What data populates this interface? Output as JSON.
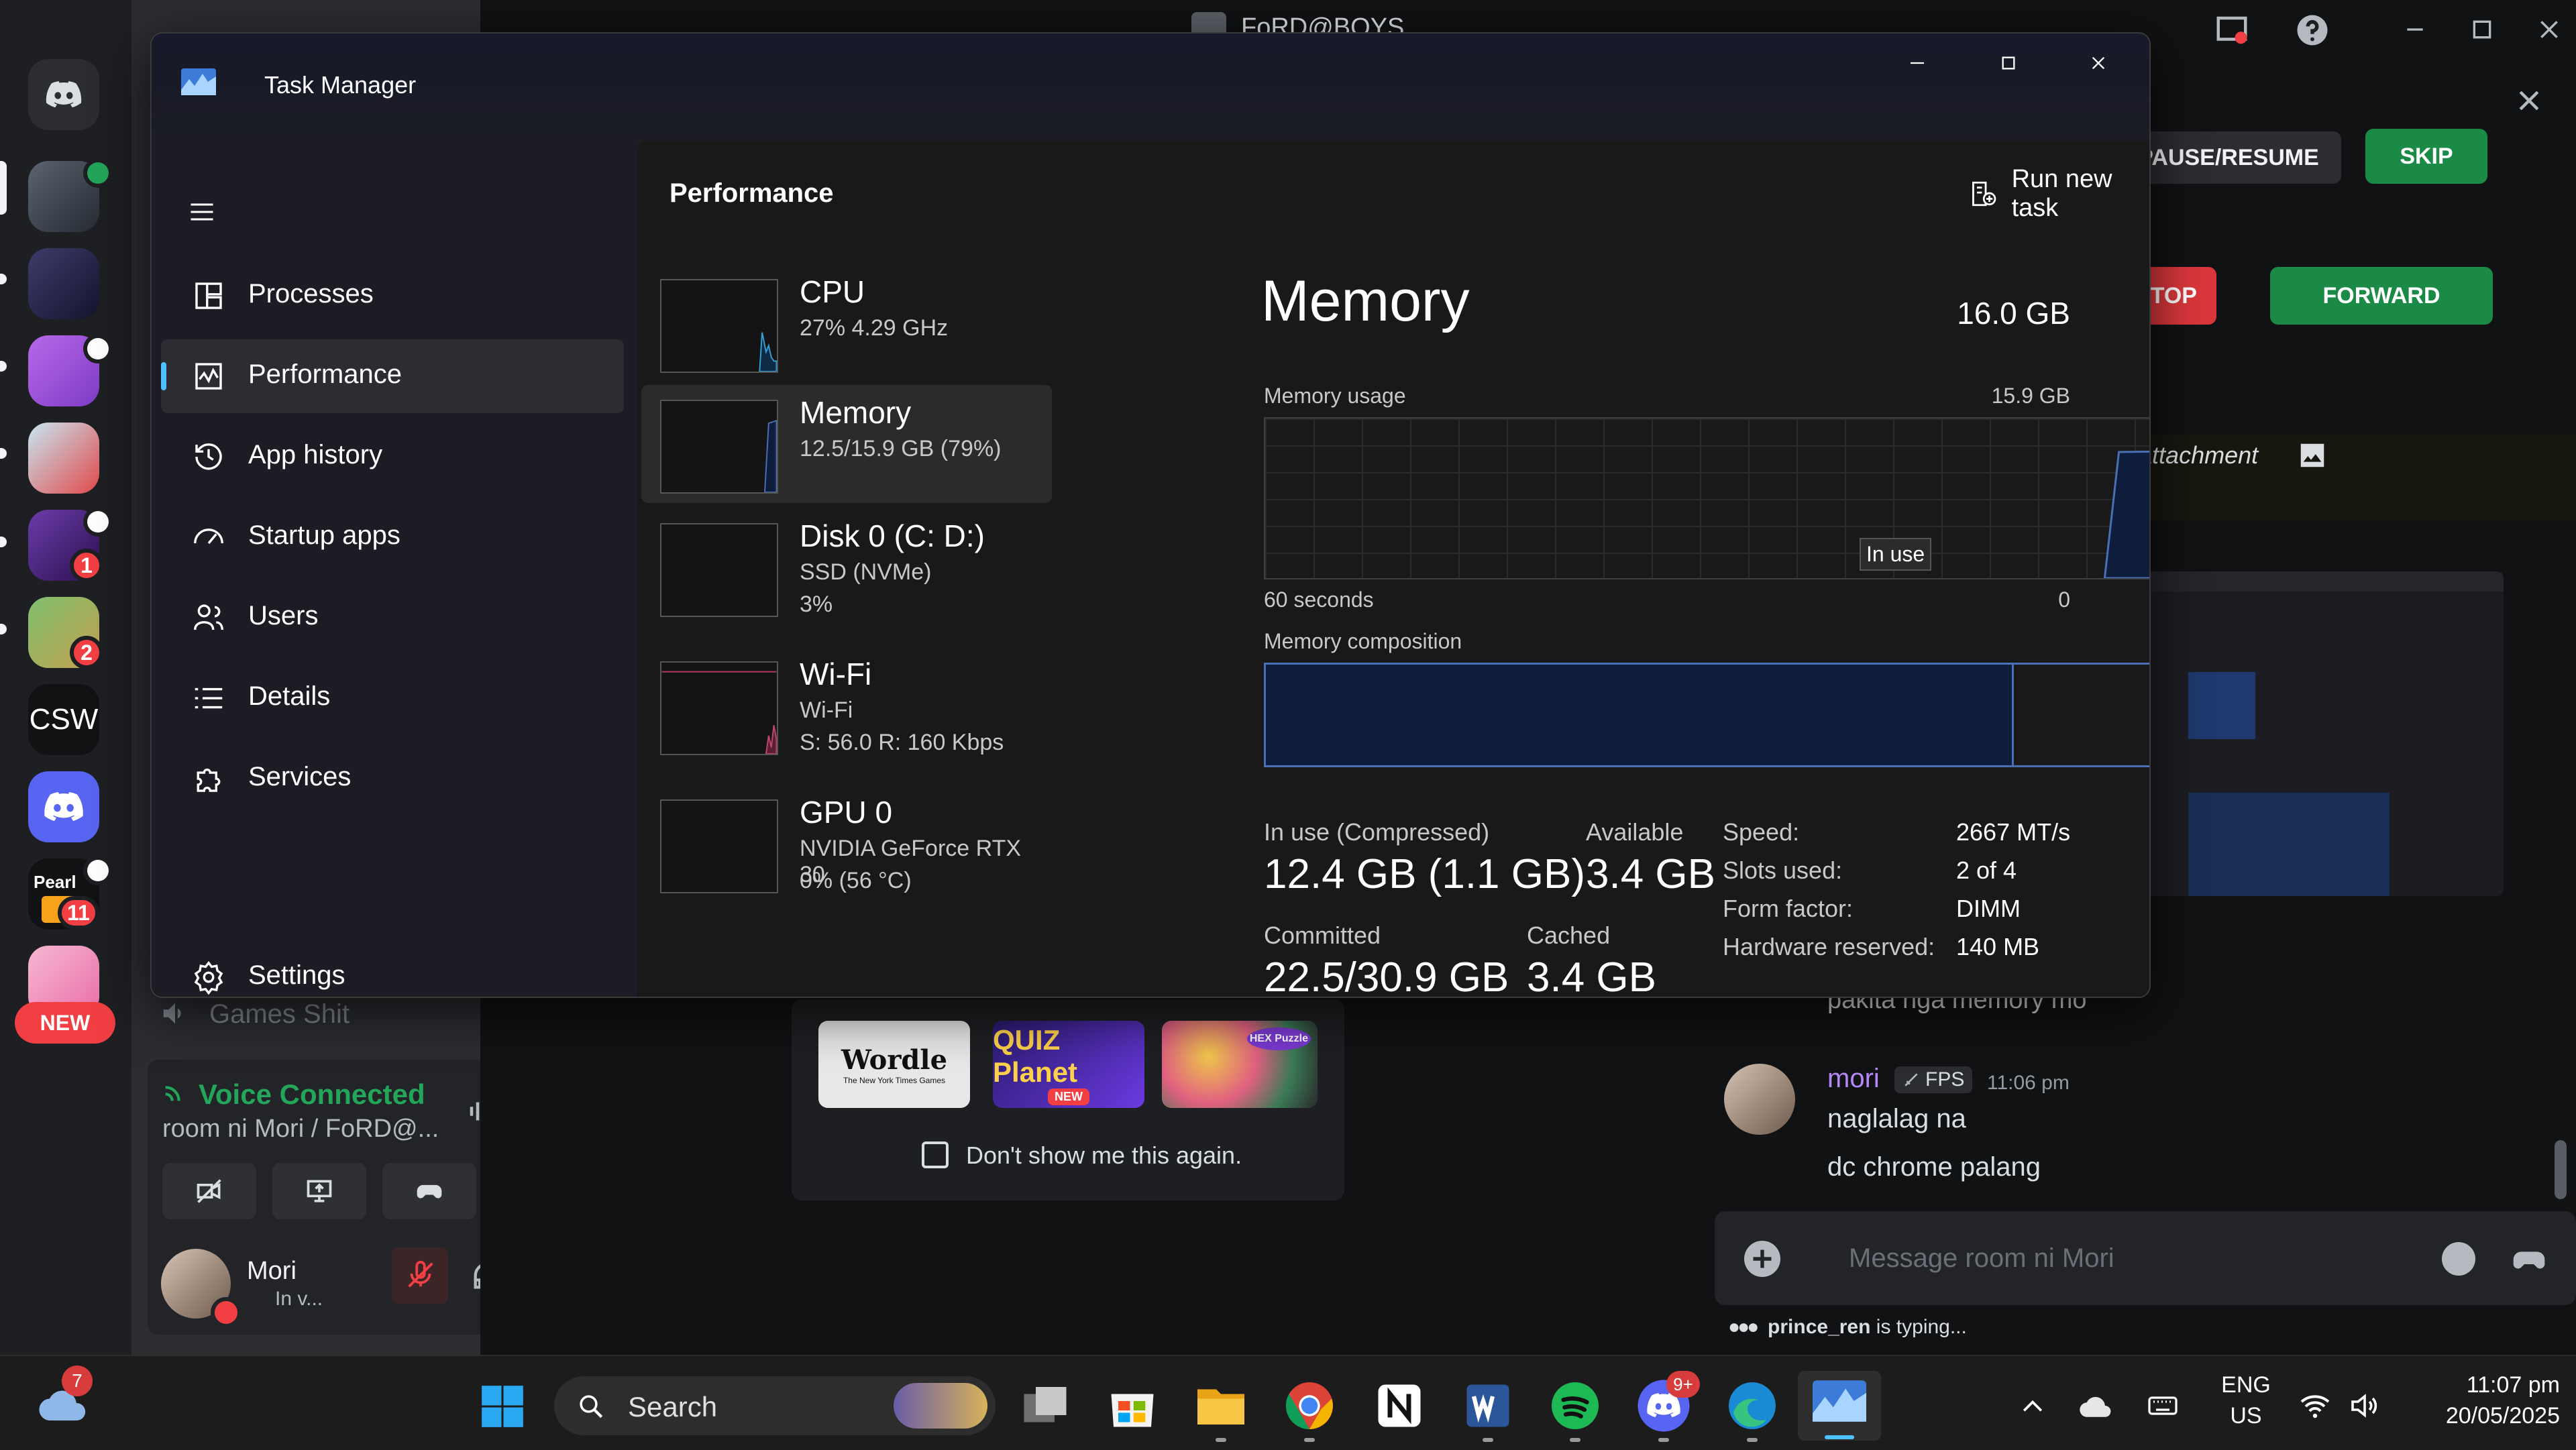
{
  "discord": {
    "window_title": "FoRD@BOYS",
    "server_badges": {
      "gengar": "1",
      "farm": "2",
      "pearl": "11"
    },
    "server_labels": {
      "csw": "CSW",
      "pearl": "Pearl"
    },
    "new_badge": "NEW",
    "channel": {
      "games_shit": "Games Shit"
    },
    "voice": {
      "status": "Voice Connected",
      "room": "room ni Mori / FoRD@..."
    },
    "user": {
      "name": "Mori",
      "status": "In v..."
    },
    "activity": {
      "apps": [
        "Wordle",
        "QUIZ Planet",
        "HEX Puzzle"
      ],
      "wordle_sub": "The New York Times Games",
      "quiz_tag": "NEW",
      "dont_show": "Don't show me this again."
    },
    "music_controls": {
      "pause": "PAUSE/RESUME",
      "skip": "SKIP",
      "stop": "STOP",
      "forward": "FORWARD"
    },
    "attachment_text": "e attachment",
    "messages": [
      {
        "text": "pakita nga memory mo"
      },
      {
        "author": "mori",
        "tag": "FPS",
        "time": "11:06 pm",
        "lines": [
          "naglalag na",
          "dc chrome palang"
        ]
      }
    ],
    "composer_placeholder": "Message room ni Mori",
    "typing": {
      "user": "prince_ren",
      "suffix": "is typing..."
    }
  },
  "task_manager": {
    "title": "Task Manager",
    "nav": [
      "Processes",
      "Performance",
      "App history",
      "Startup apps",
      "Users",
      "Details",
      "Services"
    ],
    "settings": "Settings",
    "header": {
      "title": "Performance",
      "run_new_task": "Run new task"
    },
    "cards": [
      {
        "title": "CPU",
        "lines": [
          "27%  4.29 GHz"
        ]
      },
      {
        "title": "Memory",
        "lines": [
          "12.5/15.9 GB (79%)"
        ]
      },
      {
        "title": "Disk 0 (C: D:)",
        "lines": [
          "SSD (NVMe)",
          "3%"
        ]
      },
      {
        "title": "Wi-Fi",
        "lines": [
          "Wi-Fi",
          "S: 56.0  R: 160 Kbps"
        ]
      },
      {
        "title": "GPU 0",
        "lines": [
          "NVIDIA GeForce RTX 30",
          "0%  (56 °C)"
        ]
      }
    ],
    "memory": {
      "heading": "Memory",
      "total": "16.0 GB",
      "usage_label": "Memory usage",
      "usage_max": "15.9 GB",
      "tooltip": "In use",
      "x_left": "60 seconds",
      "x_right": "0",
      "composition_label": "Memory composition",
      "usage_fraction": 0.79,
      "stats": {
        "in_use_label": "In use (Compressed)",
        "in_use_value": "12.4 GB (1.1 GB)",
        "available_label": "Available",
        "available_value": "3.4 GB",
        "committed_label": "Committed",
        "committed_value": "22.5/30.9 GB",
        "cached_label": "Cached",
        "cached_value": "3.4 GB"
      },
      "details": [
        {
          "label": "Speed:",
          "value": "2667 MT/s"
        },
        {
          "label": "Slots used:",
          "value": "2 of 4"
        },
        {
          "label": "Form factor:",
          "value": "DIMM"
        },
        {
          "label": "Hardware reserved:",
          "value": "140 MB"
        }
      ]
    }
  },
  "taskbar": {
    "weather_badge": "7",
    "search_placeholder": "Search",
    "discord_badge": "9+",
    "language": "ENG",
    "region": "US",
    "time": "11:07 pm",
    "date": "20/05/2025"
  },
  "colors": {
    "accent": "#4cc2ff",
    "memory_graph_line": "#4a6fb5",
    "memory_fill": "#0f1d3d",
    "discord_green": "#23a55a",
    "discord_red": "#da373c"
  }
}
